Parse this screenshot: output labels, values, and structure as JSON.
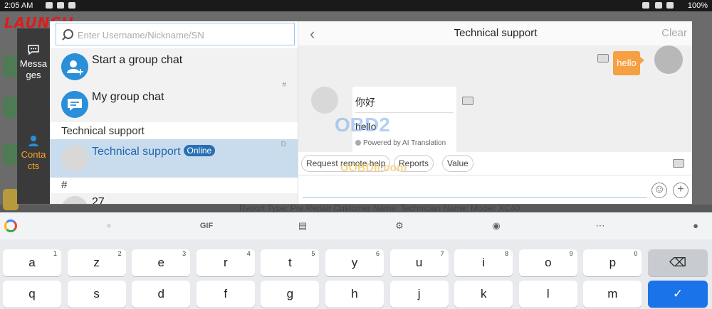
{
  "status_bar": {
    "time": "2:05 AM",
    "battery": "100%"
  },
  "background": {
    "logo": "LAUNCH",
    "report_line": "Report Type: Pre Repair  Customer Name:    Technician Name:    Model: XC40"
  },
  "rail": {
    "items": [
      {
        "label": "Messages",
        "icon": "chat-bubble-icon",
        "color": "#ffffff"
      },
      {
        "label": "Contacts",
        "icon": "person-icon",
        "color": "#f5a623"
      }
    ]
  },
  "contacts": {
    "search_placeholder": "Enter Username/Nickname/SN",
    "rows": [
      {
        "name": "Start a group chat",
        "icon": "add-group-icon"
      },
      {
        "name": "My group chat",
        "icon": "group-chat-icon"
      }
    ],
    "hash_marker": "#",
    "section_technical": "Technical support",
    "selected_contact": {
      "name": "Technical support",
      "badge": "Online",
      "index_letter": "D"
    },
    "section_hash": "#",
    "next_contact": "27"
  },
  "chat": {
    "title": "Technical support",
    "clear_label": "Clear",
    "messages": [
      {
        "from": "me",
        "text": "hello"
      },
      {
        "from": "them",
        "original": "你好",
        "translation": "hello",
        "powered_by": "Powered by AI Translation"
      }
    ],
    "quick_actions": [
      "Request remote help",
      "Reports",
      "Value"
    ]
  },
  "watermark": {
    "line1": "OBD2",
    "line2": "UOBDII.com"
  },
  "keyboard": {
    "toolbar": [
      "sticker-icon",
      "GIF",
      "clipboard-icon",
      "settings-gear-icon",
      "palette-icon",
      "more-icon",
      "mic-icon"
    ],
    "gif_label": "GIF",
    "row1": [
      {
        "key": "a",
        "hint": "1"
      },
      {
        "key": "z",
        "hint": "2"
      },
      {
        "key": "e",
        "hint": "3"
      },
      {
        "key": "r",
        "hint": "4"
      },
      {
        "key": "t",
        "hint": "5"
      },
      {
        "key": "y",
        "hint": "6"
      },
      {
        "key": "u",
        "hint": "7"
      },
      {
        "key": "i",
        "hint": "8"
      },
      {
        "key": "o",
        "hint": "9"
      },
      {
        "key": "p",
        "hint": "0"
      }
    ],
    "row2": [
      "q",
      "s",
      "d",
      "f",
      "g",
      "h",
      "j",
      "k",
      "l",
      "m"
    ],
    "backspace_symbol": "⌫",
    "enter_symbol": "✓"
  }
}
